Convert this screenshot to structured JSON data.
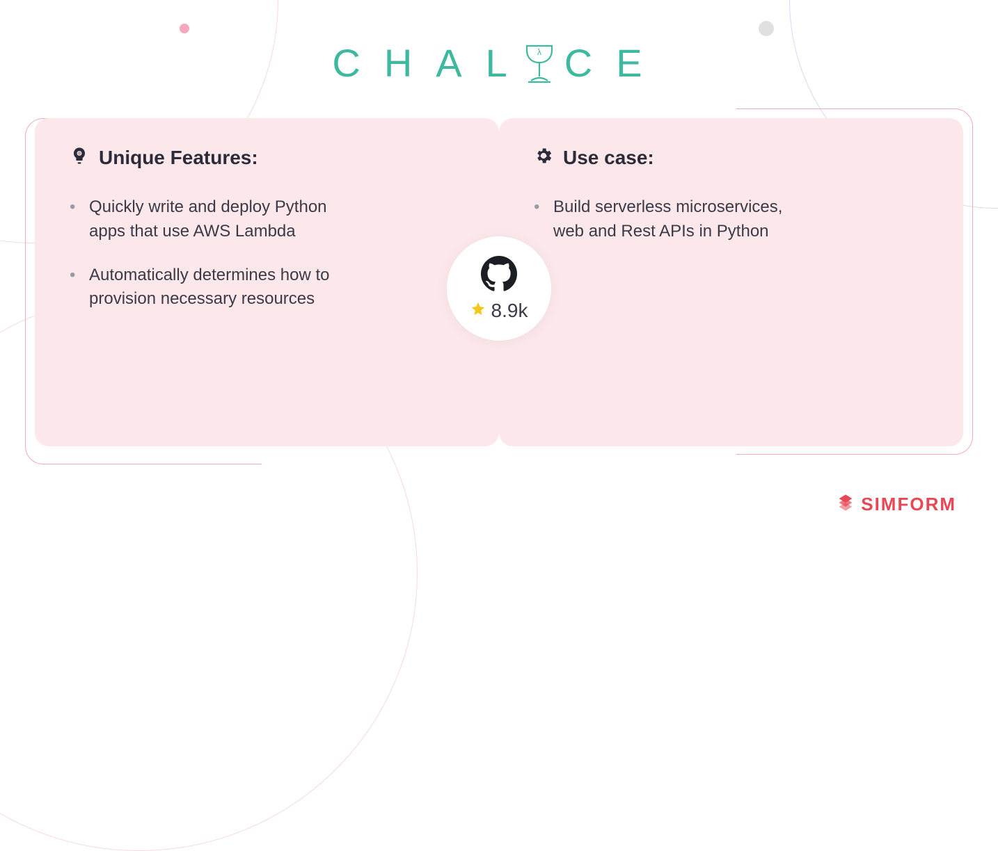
{
  "title": {
    "part1": "CHAL",
    "part2": "CE"
  },
  "left_card": {
    "heading": "Unique Features:",
    "bullets": [
      "Quickly write and deploy Python apps that use AWS Lambda",
      "Automatically determines how to provision necessary resources"
    ]
  },
  "right_card": {
    "heading": "Use case:",
    "bullets": [
      "Build serverless microservices, web and Rest APIs in Python"
    ]
  },
  "github": {
    "stars": "8.9k"
  },
  "brand": "SIMFORM"
}
